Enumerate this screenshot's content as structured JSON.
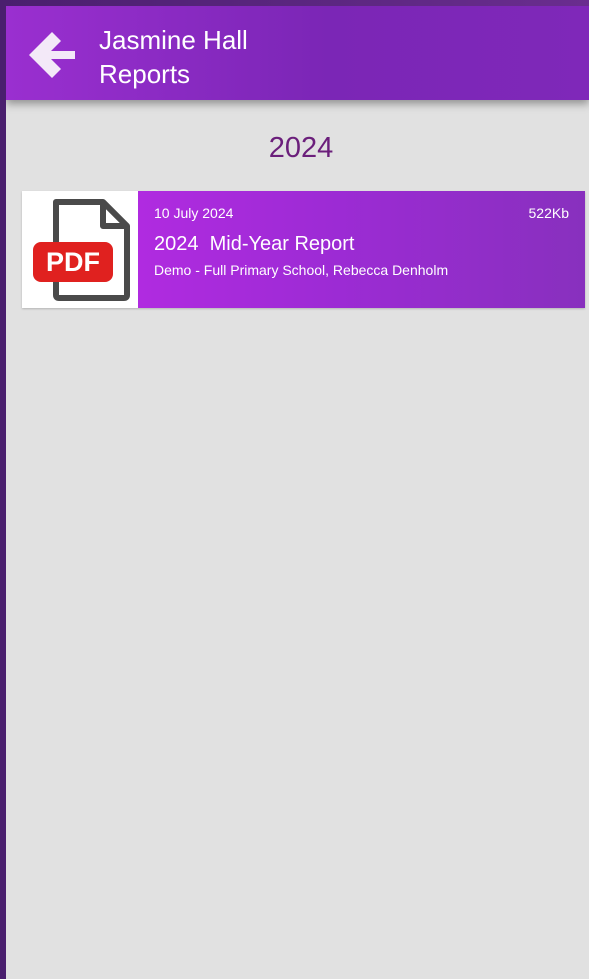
{
  "header": {
    "title_line1": "Jasmine Hall",
    "title_line2": "Reports",
    "back_icon": "arrow-left-icon",
    "background_color": "#8a2bc2"
  },
  "year_section": {
    "year": "2024",
    "color": "#6b1f7b"
  },
  "reports": [
    {
      "date": "10 July 2024",
      "size": "522Kb",
      "title": "2024  Mid-Year Report",
      "subtitle": "Demo - Full Primary School, Rebecca Denholm",
      "file_type_label": "PDF",
      "icon": "pdf-file-icon"
    }
  ],
  "colors": {
    "accent_purple": "#9b2fd3",
    "screen_background": "#e1e1e1",
    "pdf_red": "#e0211f"
  }
}
